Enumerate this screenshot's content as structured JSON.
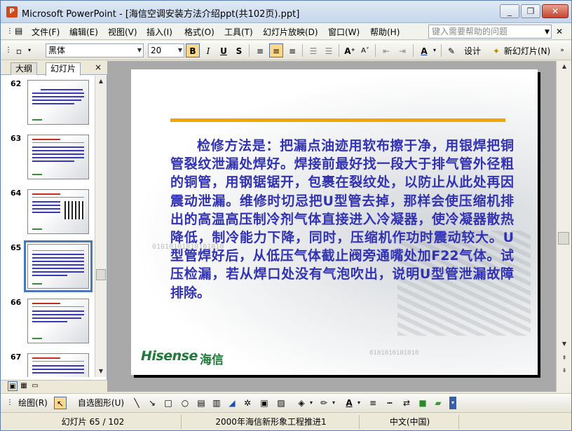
{
  "window": {
    "app_icon_label": "P",
    "title": "Microsoft PowerPoint - [海信空调安装方法介绍ppt(共102页).ppt]",
    "controls": {
      "minimize": "_",
      "restore": "❐",
      "close": "✕"
    }
  },
  "menubar": {
    "items": [
      {
        "label": "文件(F)"
      },
      {
        "label": "编辑(E)"
      },
      {
        "label": "视图(V)"
      },
      {
        "label": "插入(I)"
      },
      {
        "label": "格式(O)"
      },
      {
        "label": "工具(T)"
      },
      {
        "label": "幻灯片放映(D)"
      },
      {
        "label": "窗口(W)"
      },
      {
        "label": "帮助(H)"
      }
    ],
    "help_placeholder": "键入需要帮助的问题",
    "close": "✕"
  },
  "toolbar": {
    "font_name": "黑体",
    "font_size": "20",
    "bold": "B",
    "italic": "I",
    "underline": "U",
    "shadow": "S",
    "font_color_icon": "A",
    "design_label": "设计(S)",
    "new_slide_label": "新幻灯片(N)"
  },
  "panel": {
    "tabs": [
      "大纲",
      "幻灯片"
    ],
    "close": "×",
    "thumbnails": [
      {
        "number": "62",
        "selected": false
      },
      {
        "number": "63",
        "selected": false
      },
      {
        "number": "64",
        "selected": false
      },
      {
        "number": "65",
        "selected": true
      },
      {
        "number": "66",
        "selected": false
      },
      {
        "number": "67",
        "selected": false
      }
    ]
  },
  "slide": {
    "body": "检修方法是：把漏点油迹用软布擦于净，用银焊把铜管裂纹泄漏处焊好。焊接前最好找一段大于排气管外径粗的铜管，用钢锯锯开，包裹在裂纹处，以防止从此处再因震动泄漏。维修时切忌把U型管去掉，那样会使压缩机排出的高温高压制冷剂气体直接进入冷凝器，使冷凝器散热降低，制冷能力下降，同时，压缩机作功时震动较大。U型管焊好后，从低压气体截止阀旁通嘴处加F22气体。试压检漏，若从焊口处没有气泡吹出，说明U型管泄漏故障排除。",
    "logo_en": "Hisense",
    "logo_cn": "海信",
    "bg_digits_1": "01010101010101010",
    "bg_digits_2": "0101010101010",
    "accent_orange": "#f6a500",
    "text_color": "#3232b4"
  },
  "drawbar": {
    "draw_label": "绘图(R)",
    "autoshapes_label": "自选图形(U)"
  },
  "statusbar": {
    "slide_info": "幻灯片 65 / 102",
    "design_name": "2000年海信新形象工程推进1",
    "language": "中文(中国)"
  }
}
